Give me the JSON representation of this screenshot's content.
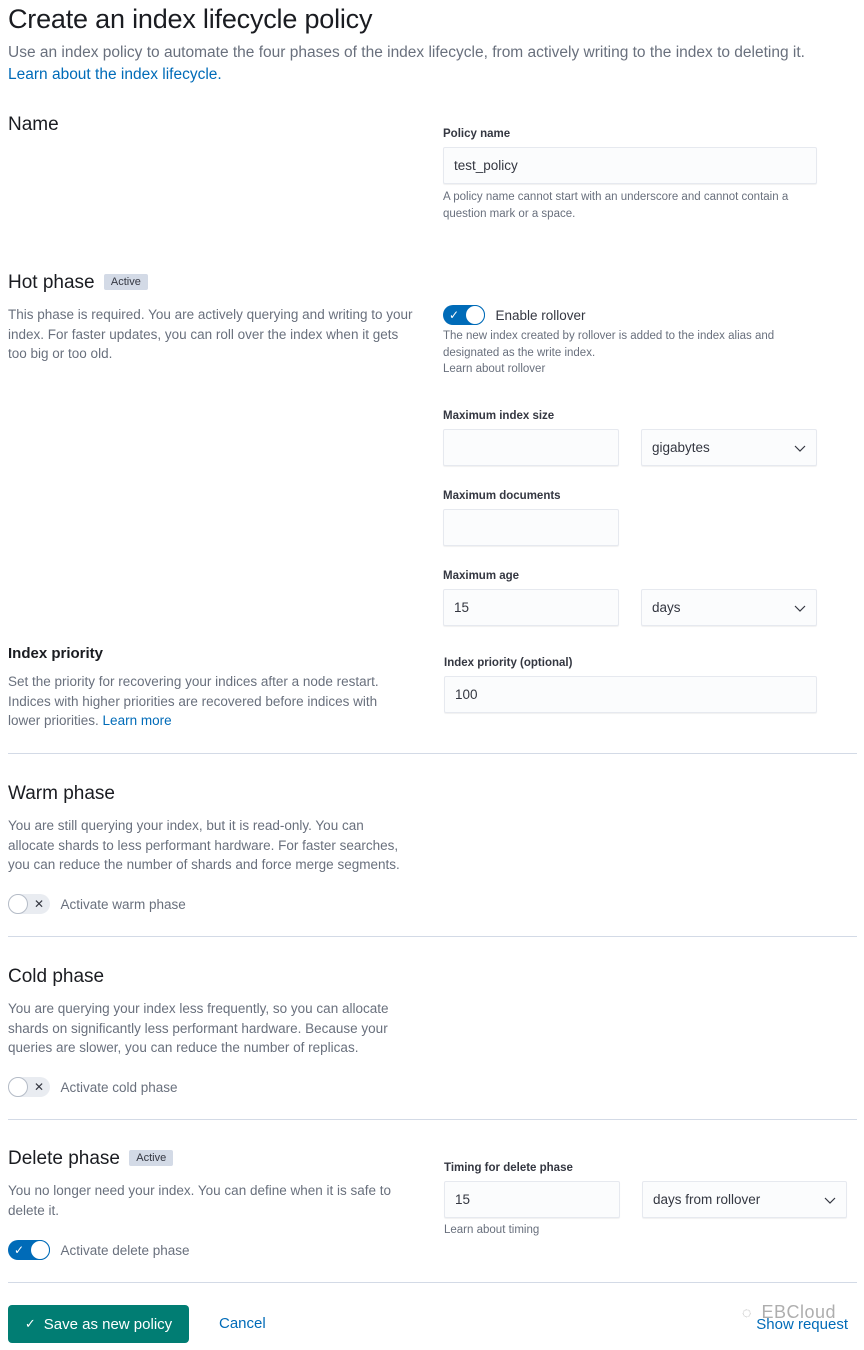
{
  "header": {
    "title": "Create an index lifecycle policy",
    "description": "Use an index policy to automate the four phases of the index lifecycle, from actively writing to the index to deleting it.",
    "learn_link": "Learn about the index lifecycle."
  },
  "name_section": {
    "title": "Name",
    "field_label": "Policy name",
    "field_value": "test_policy",
    "help_text": "A policy name cannot start with an underscore and cannot contain a question mark or a space."
  },
  "hot_phase": {
    "title": "Hot phase",
    "badge": "Active",
    "description": "This phase is required. You are actively querying and writing to your index. For faster updates, you can roll over the index when it gets too big or too old.",
    "rollover_toggle": {
      "label": "Enable rollover",
      "checked": true
    },
    "rollover_help": "The new index created by rollover is added to the index alias and designated as the write index.",
    "rollover_link": "Learn about rollover",
    "max_index_size": {
      "label": "Maximum index size",
      "value": "",
      "unit": "gigabytes"
    },
    "max_documents": {
      "label": "Maximum documents",
      "value": ""
    },
    "max_age": {
      "label": "Maximum age",
      "value": "15",
      "unit": "days"
    }
  },
  "index_priority": {
    "title": "Index priority",
    "description": "Set the priority for recovering your indices after a node restart. Indices with higher priorities are recovered before indices with lower priorities.",
    "learn_link": "Learn more",
    "field_label": "Index priority (optional)",
    "field_value": "100"
  },
  "warm_phase": {
    "title": "Warm phase",
    "description": "You are still querying your index, but it is read-only. You can allocate shards to less performant hardware. For faster searches, you can reduce the number of shards and force merge segments.",
    "toggle": {
      "label": "Activate warm phase",
      "checked": false
    }
  },
  "cold_phase": {
    "title": "Cold phase",
    "description": "You are querying your index less frequently, so you can allocate shards on significantly less performant hardware. Because your queries are slower, you can reduce the number of replicas.",
    "toggle": {
      "label": "Activate cold phase",
      "checked": false
    }
  },
  "delete_phase": {
    "title": "Delete phase",
    "badge": "Active",
    "description": "You no longer need your index. You can define when it is safe to delete it.",
    "toggle": {
      "label": "Activate delete phase",
      "checked": true
    },
    "timing": {
      "label": "Timing for delete phase",
      "value": "15",
      "unit": "days from rollover"
    },
    "timing_link": "Learn about timing"
  },
  "footer": {
    "save_label": "Save as new policy",
    "cancel_label": "Cancel",
    "show_request_label": "Show request",
    "watermark": "EBCloud"
  },
  "icons": {
    "check": "✓",
    "cross": "✕"
  },
  "colors": {
    "primary": "#006bb8",
    "success": "#017d73",
    "badge_bg": "#d3dae6",
    "text_subdued": "#69707d"
  }
}
